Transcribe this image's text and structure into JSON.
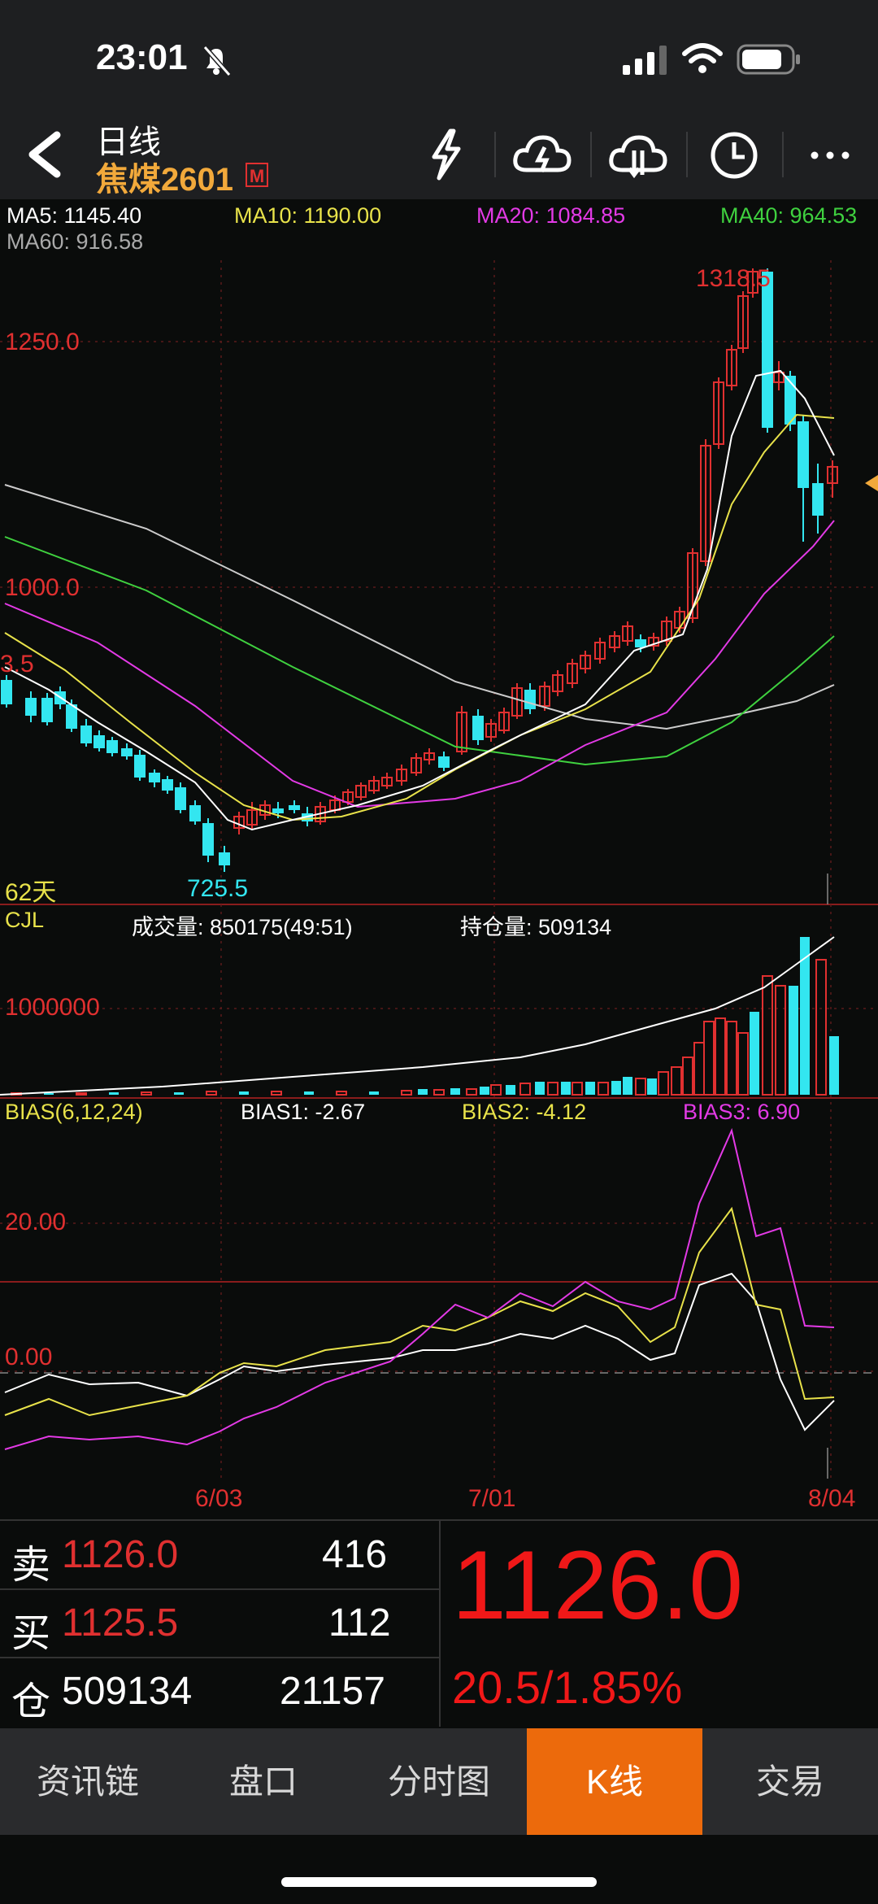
{
  "status_bar": {
    "time": "23:01"
  },
  "header": {
    "title": "日线",
    "subtitle": "焦煤2601",
    "badge": "M"
  },
  "ma_legend": {
    "ma5": "MA5: 1145.40",
    "ma10": "MA10: 1190.00",
    "ma20": "MA20: 1084.85",
    "ma40": "MA40: 964.53",
    "ma60": "MA60: 916.58"
  },
  "price_chart": {
    "high_label": "1318.5",
    "low_label": "725.5",
    "y_label_1250": "1250.0",
    "y_label_1000": "1000.0",
    "left_edge_label": "3.5",
    "period_label": "62天"
  },
  "volume_panel": {
    "name": "CJL",
    "volume": "成交量: 850175(49:51)",
    "open_interest": "持仓量: 509134",
    "y_label": "1000000"
  },
  "bias_panel": {
    "name": "BIAS(6,12,24)",
    "bias1": "BIAS1: -2.67",
    "bias2": "BIAS2: -4.12",
    "bias3": "BIAS3: 6.90",
    "y_label_20": "20.00",
    "y_label_0": "0.00"
  },
  "x_axis": {
    "d1": "6/03",
    "d2": "7/01",
    "d3": "8/04"
  },
  "quote": {
    "sell_label": "卖",
    "sell_price": "1126.0",
    "sell_qty": "416",
    "buy_label": "买",
    "buy_price": "1125.5",
    "buy_qty": "112",
    "oi_label": "仓",
    "oi_value": "509134",
    "oi_change": "21157",
    "last_price": "1126.0",
    "change": "20.5/1.85%"
  },
  "tabs": [
    "资讯链",
    "盘口",
    "分时图",
    "K线",
    "交易"
  ],
  "colors": {
    "up": "#e03030",
    "down": "#33e6f0",
    "ma5": "#ffffff",
    "ma10": "#e8e24a",
    "ma20": "#e33ae6",
    "ma40": "#3fd13f",
    "ma60": "#cccccc",
    "accent": "#ec6a0c"
  }
}
